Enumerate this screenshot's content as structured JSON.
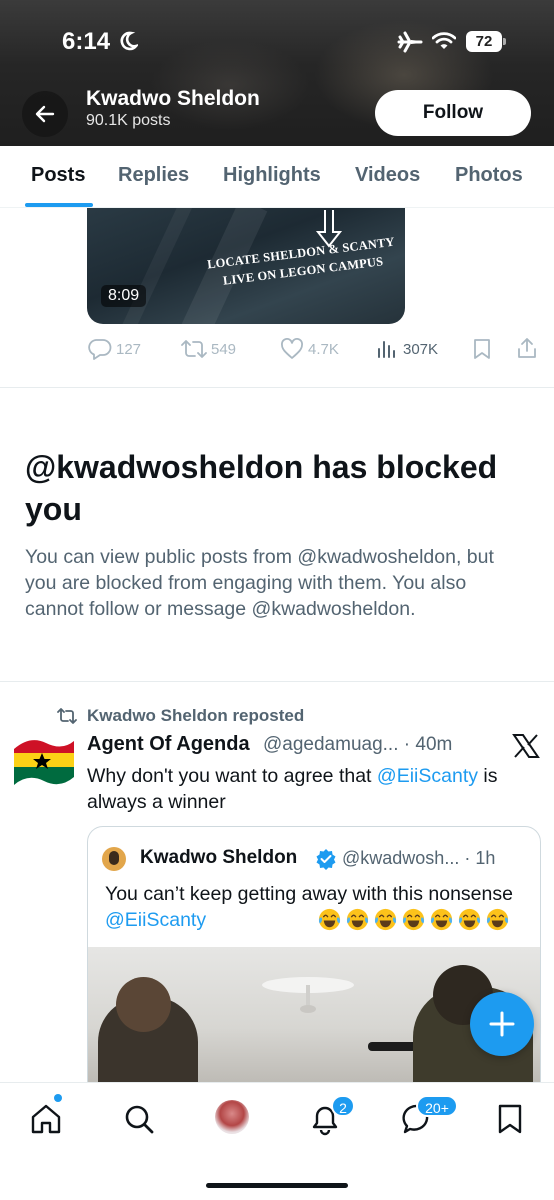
{
  "status_bar": {
    "time": "6:14",
    "battery": "72"
  },
  "header": {
    "name": "Kwadwo Sheldon",
    "post_count": "90.1K posts",
    "follow_label": "Follow"
  },
  "tabs": [
    {
      "label": "Posts",
      "active": true
    },
    {
      "label": "Replies",
      "active": false
    },
    {
      "label": "Highlights",
      "active": false
    },
    {
      "label": "Videos",
      "active": false
    },
    {
      "label": "Photos",
      "active": false
    }
  ],
  "video_post": {
    "caption_line1": "LOCATE SHELDON & SCANTY",
    "caption_line2": "LIVE ON LEGON CAMPUS",
    "duration": "8:09",
    "replies": "127",
    "reposts": "549",
    "likes": "4.7K",
    "views": "307K"
  },
  "blocked_notice": {
    "title": "@kwadwosheldon has blocked you",
    "body": "You can view public posts from @kwadwosheldon, but you are blocked from engaging with them. You also cannot follow or message @kwadwosheldon."
  },
  "repost": {
    "label": "Kwadwo Sheldon reposted",
    "author_name": "Agent Of Agenda",
    "author_handle_time": "@agedamuag... · 40m",
    "text_before": "Why don't you want to agree that ",
    "mention": "@EiiScanty",
    "text_after": " is always a winner",
    "quote": {
      "author_name": "Kwadwo Sheldon",
      "handle_time": "@kwadwosh... · 1h",
      "text_before": "You can’t keep getting away with this nonsense ",
      "mention": "@EiiScanty",
      "emoji_count": 7
    }
  },
  "bottom_nav": {
    "notifications_badge": "2",
    "messages_badge": "20+"
  },
  "colors": {
    "accent": "#1d9bf0",
    "text": "#0f1419",
    "secondary": "#536471"
  }
}
